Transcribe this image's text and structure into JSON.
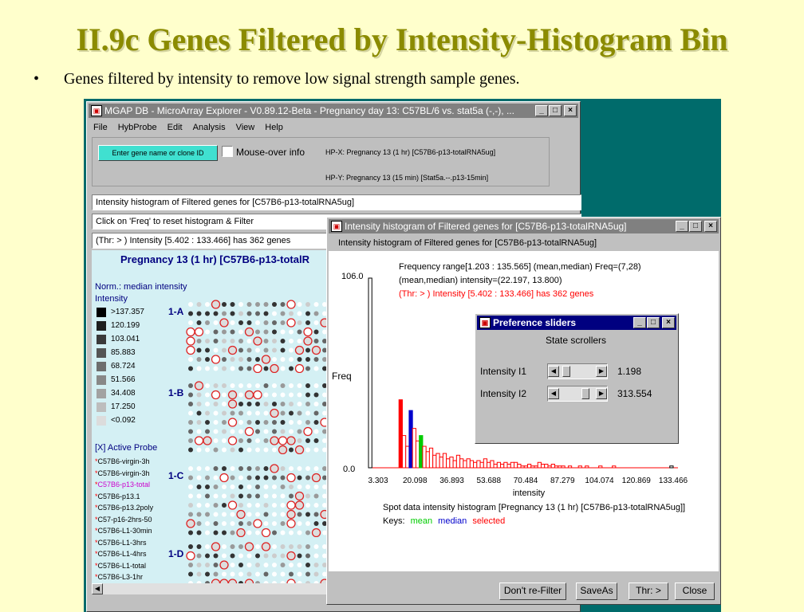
{
  "slide": {
    "title": "II.9c Genes Filtered by Intensity-Histogram Bin",
    "bullet": "Genes filtered by intensity to remove low signal strength sample genes."
  },
  "main_window": {
    "title": "MGAP DB - MicroArray Explorer - V0.89.12-Beta - Pregnancy day 13: C57BL/6 vs. stat5a (-,-), ...",
    "menu": [
      "File",
      "HybProbe",
      "Edit",
      "Analysis",
      "View",
      "Help"
    ],
    "enter_gene_button": "Enter gene name or clone ID",
    "mouseover_label": "Mouse-over info",
    "hp_x": "HP-X: Pregnancy 13  (1 hr) [C57B6-p13-totalRNA5ug]",
    "hp_y": "HP-Y: Pregnancy 13  (15 min) [Stat5a.--.p13-15min]",
    "status1": "Intensity histogram of Filtered genes for [C57B6-p13-totalRNA5ug]",
    "status2": "Click on 'Freq' to reset histogram & Filter",
    "status3": "(Thr: > ) Intensity [5.402 : 133.466] has 362 genes",
    "array_title": "Pregnancy 13  (1 hr) [C57B6-p13-totalR",
    "norm_label": "Norm.: median intensity",
    "intensity_label": "Intensity",
    "legend": [
      {
        "label": ">137.357",
        "color": "#000000"
      },
      {
        "label": "120.199",
        "color": "#1e1e1e"
      },
      {
        "label": "103.041",
        "color": "#3a3a3a"
      },
      {
        "label": "85.883",
        "color": "#555555"
      },
      {
        "label": "68.724",
        "color": "#6e6e6e"
      },
      {
        "label": "51.566",
        "color": "#888888"
      },
      {
        "label": "34.408",
        "color": "#a2a2a2"
      },
      {
        "label": "17.250",
        "color": "#bdbdbd"
      },
      {
        "label": "<0.092",
        "color": "#dcdcdc"
      }
    ],
    "active_probe_label": "[X] Active Probe",
    "probes": [
      {
        "label": "C57B6-virgin-3h",
        "highlight": false
      },
      {
        "label": "C57B6-virgin-3h",
        "highlight": false
      },
      {
        "label": "C57B6-p13-total",
        "highlight": true
      },
      {
        "label": "C57B6-p13.1",
        "highlight": false
      },
      {
        "label": "C57B6-p13.2poly",
        "highlight": false
      },
      {
        "label": "C57-p16-2hrs-50",
        "highlight": false
      },
      {
        "label": "C57B6-L1-30min",
        "highlight": false
      },
      {
        "label": "C57B6-L1-3hrs",
        "highlight": false
      },
      {
        "label": "C57B6-L1-4hrs",
        "highlight": false
      },
      {
        "label": "C57B6-L1-total",
        "highlight": false
      },
      {
        "label": "C57B6-L3-1hr",
        "highlight": false
      }
    ],
    "sections": [
      "1-A",
      "1-B",
      "1-C",
      "1-D"
    ]
  },
  "hist_window": {
    "title": "Intensity histogram of Filtered genes for [C57B6-p13-totalRNA5ug]",
    "subtitle": "Intensity histogram of Filtered genes for [C57B6-p13-totalRNA5ug]",
    "freq_range": "Frequency range[1.203 : 135.565] (mean,median) Freq=(7,28)",
    "mean_median": "(mean,median) intensity=(22.197, 13.800)",
    "threshold": "(Thr: > ) Intensity [5.402 : 133.466] has 362 genes",
    "ymax_label": "106.0",
    "ymin_label": "0.0",
    "freq_label": "Freq",
    "x_ticks": [
      "3.303",
      "20.098",
      "36.893",
      "53.688",
      "70.484",
      "87.279",
      "104.074",
      "120.869",
      "133.466"
    ],
    "x_axis_label": "intensity",
    "caption": "Spot data intensity histogram [Pregnancy 13  (1 hr) [C57B6-p13-totalRNA5ug]]",
    "keys_label": "Keys:",
    "key_mean": "mean",
    "key_median": "median",
    "key_selected": "selected",
    "colors": {
      "mean": "#00cc00",
      "median": "#0000cc",
      "selected": "#ff0000"
    },
    "buttons": [
      "Don't re-Filter",
      "SaveAs",
      "Thr: >",
      "Close"
    ],
    "bins": [
      106,
      0,
      0,
      0,
      0,
      0,
      0,
      0,
      0,
      38,
      18,
      12,
      32,
      22,
      15,
      18,
      12,
      9,
      11,
      7,
      8,
      6,
      8,
      5,
      6,
      4,
      7,
      5,
      4,
      5,
      4,
      3,
      4,
      3,
      5,
      3,
      4,
      2,
      3,
      2,
      3,
      2,
      3,
      3,
      2,
      1,
      1,
      2,
      1,
      1,
      3,
      2,
      2,
      1,
      2,
      1,
      1,
      1,
      0,
      1,
      0,
      0,
      1,
      0,
      1,
      0,
      0,
      0,
      1,
      0,
      0,
      0,
      1,
      0,
      0,
      0,
      0,
      0,
      0,
      0,
      0,
      0,
      0,
      0,
      0,
      0,
      0,
      0,
      0,
      1
    ],
    "bin_colors": {
      "0": "white",
      "9": "selected",
      "12": "median",
      "15": "mean",
      "89": "white"
    }
  },
  "pref_window": {
    "title": "Preference sliders",
    "subtitle": "State scrollers",
    "sliders": [
      {
        "label": "Intensity I1",
        "value": "1.198",
        "level": 0.1
      },
      {
        "label": "Intensity I2",
        "value": "313.554",
        "level": 0.78
      }
    ]
  }
}
